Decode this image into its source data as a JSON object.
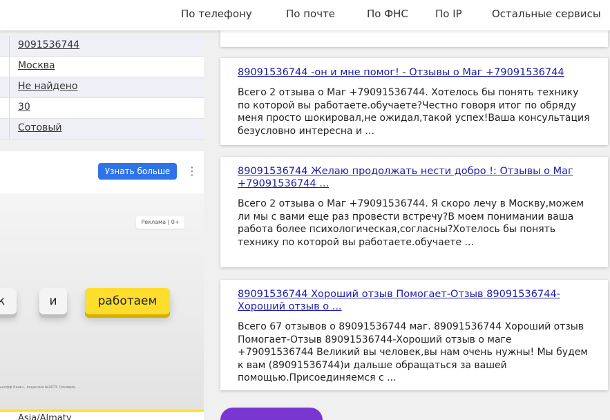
{
  "nav": {
    "items": [
      {
        "label": "По телефону"
      },
      {
        "label": "По почте"
      },
      {
        "label": "По ФНС"
      },
      {
        "label": "По IP"
      },
      {
        "label": "Остальные сервисы"
      }
    ]
  },
  "info": {
    "rows": [
      {
        "value": "9091536744"
      },
      {
        "value": "Москва"
      },
      {
        "value": "Не найдено"
      },
      {
        "value": "30"
      },
      {
        "value": "Сотовый"
      }
    ],
    "bottom_value": "Asia/Almaty"
  },
  "ad": {
    "button_label": "Узнать больше",
    "more_icon": "⋮",
    "label": "Реклама | 0+",
    "keys": [
      "к",
      "и",
      "работаем"
    ],
    "fine_print": "ькофф Банк», лицензия №2673. Реклама.",
    "brand_color": "#ffdd2d"
  },
  "results": [
    {
      "title": "89091536744 -он и мне помог! - Отзывы о Маг +79091536744",
      "body": "Всего 2 отзыва о Маг +79091536744. Хотелось бы понять технику по которой вы работаете.обучаете?Честно говоря итог по обряду меня просто шокировал,не ожидал,такой успех!Ваша консультация безусловно интересна и ..."
    },
    {
      "title": "89091536744 Желаю продолжать нести добро !: Отзывы о Маг +79091536744 ...",
      "body": "Всего 2 отзыва о Маг +79091536744. Я скоро лечу в Москву,можем ли мы с вами еще раз провести встречу?В моем понимании ваша работа более психологическая,согласны?Хотелось бы понять технику по которой вы работаете.обучаете ..."
    },
    {
      "title": "89091536744 Хороший отзыв Помогает-Отзыв 89091536744-Хороший отзыв о ...",
      "body": "Всего 67 отзывов о 89091536744 маг. 89091536744 Хороший отзыв Помогает-Отзыв 89091536744-Хороший отзыв о маге +79091536744 Великий вы человек,вы нам очень нужны! Мы будем к вам (89091536744)и дальше обращаться за вашей помощью.Присоединяемся с ..."
    }
  ],
  "colors": {
    "link": "#1d1da8",
    "button": "#2f73e8",
    "purple_button": "#7a36d0"
  }
}
